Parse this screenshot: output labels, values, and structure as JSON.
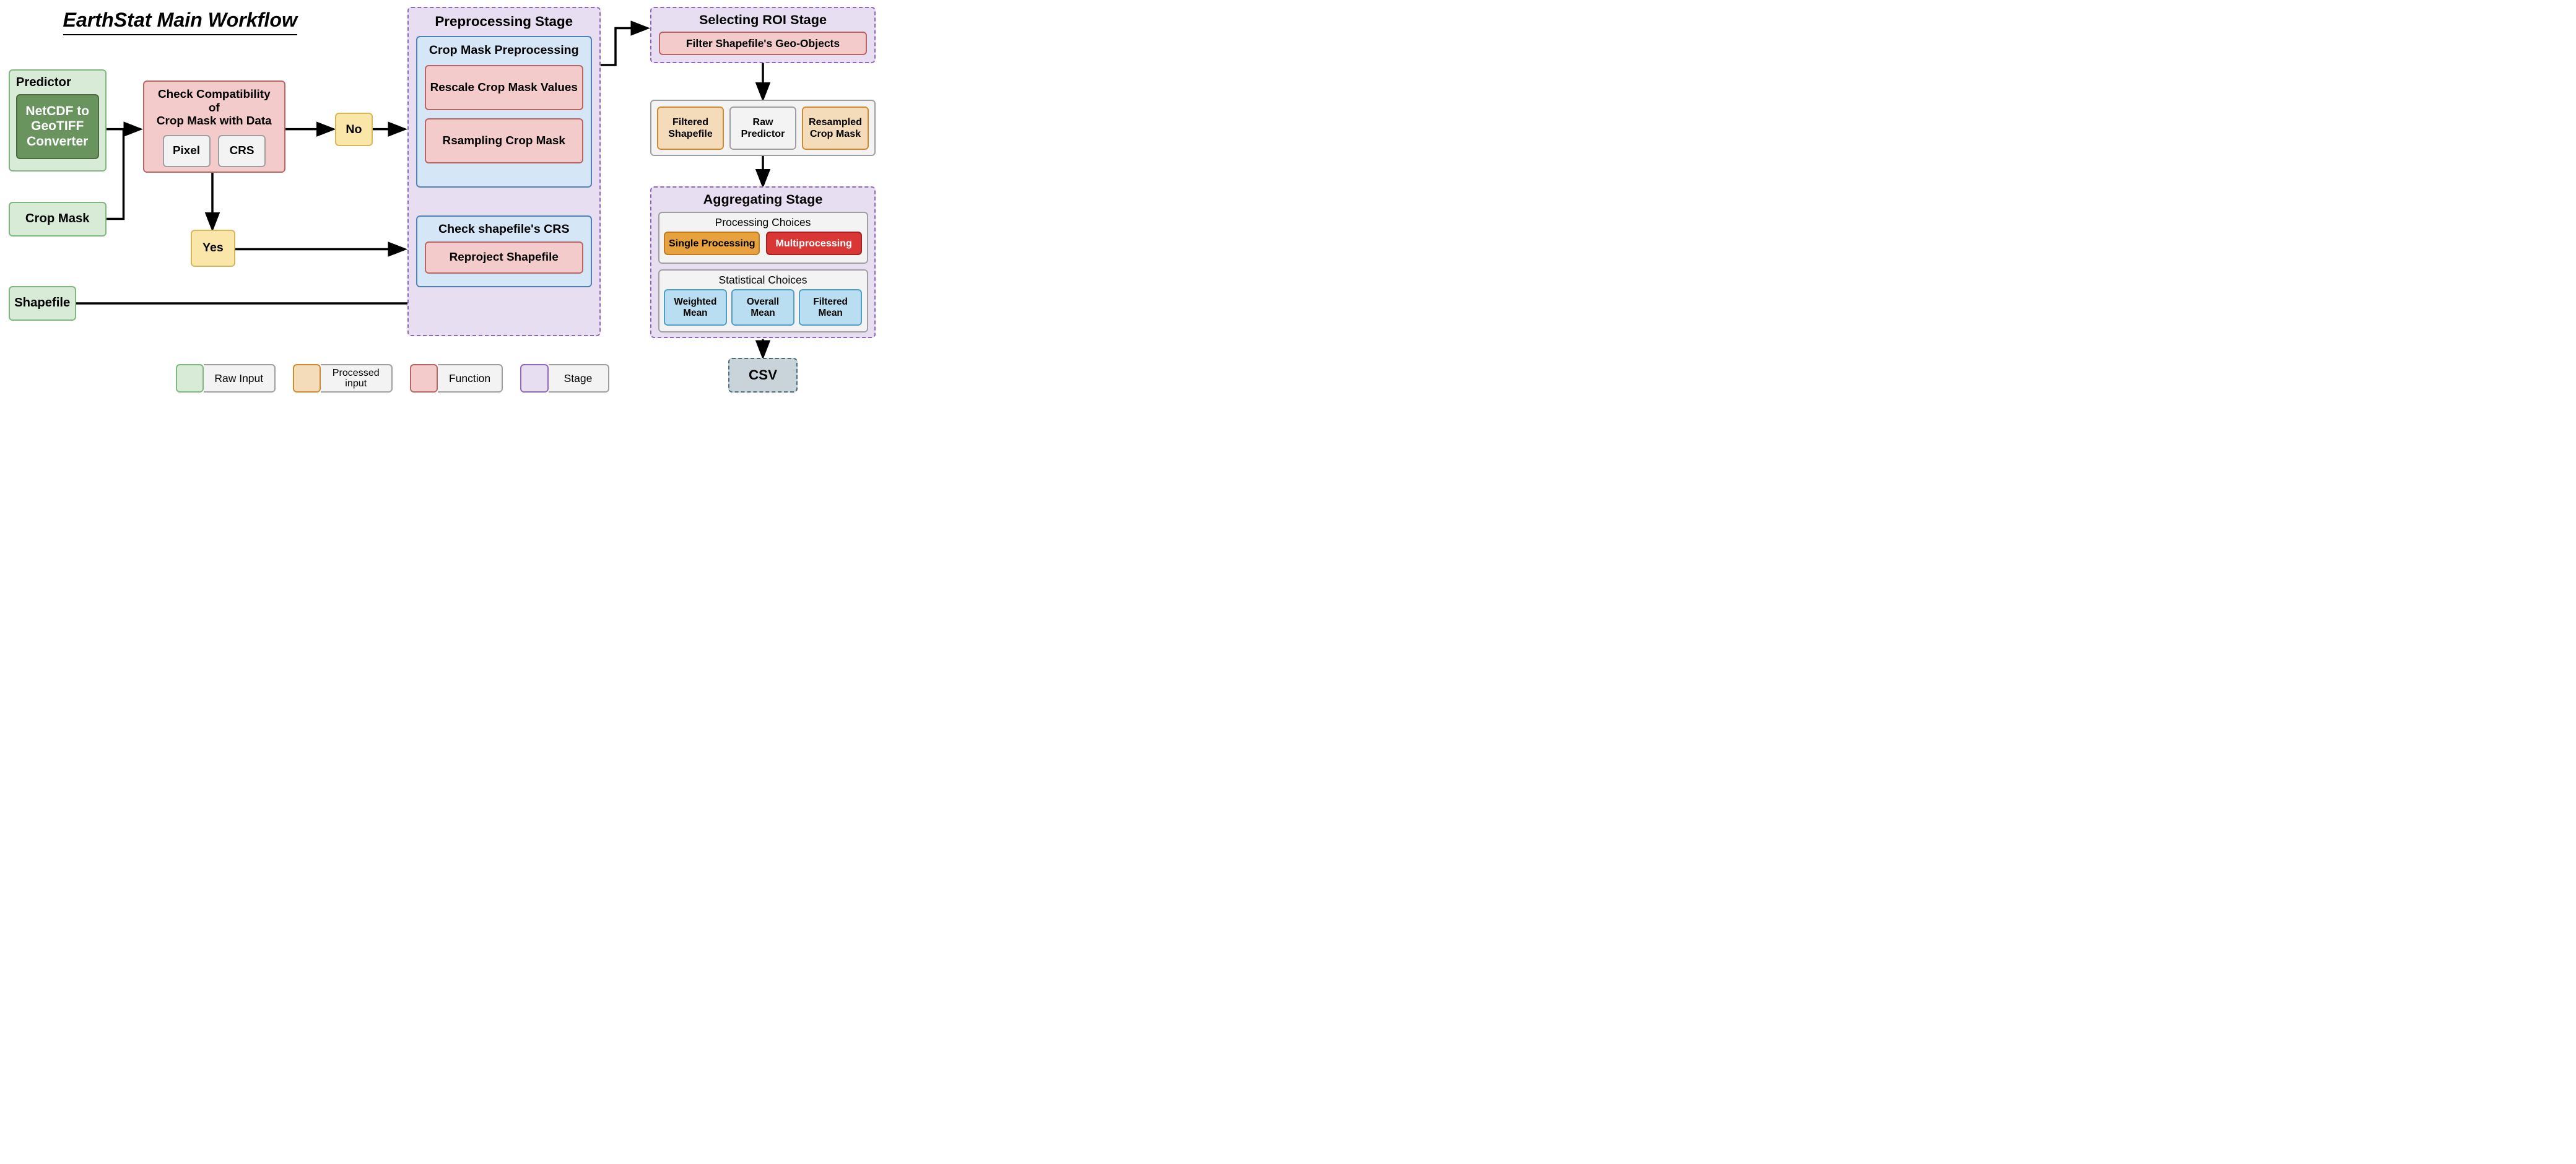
{
  "title": "EarthStat Main Workflow",
  "inputs": {
    "predictor_label": "Predictor",
    "converter": "NetCDF to GeoTIFF Converter",
    "crop_mask": "Crop Mask",
    "shapefile": "Shapefile"
  },
  "check": {
    "title1": "Check Compatibility of",
    "title2": "Crop Mask with Data",
    "pixel": "Pixel",
    "crs": "CRS"
  },
  "decision": {
    "no": "No",
    "yes": "Yes"
  },
  "preprocessing": {
    "stage_title": "Preprocessing Stage",
    "cm_prep_title": "Crop Mask Preprocessing",
    "rescale": "Rescale Crop Mask Values",
    "resample": "Rsampling Crop Mask",
    "shp_crs_title": "Check shapefile's CRS",
    "reproject": "Reproject Shapefile"
  },
  "roi": {
    "stage_title": "Selecting ROI Stage",
    "filter": "Filter Shapefile's Geo-Objects"
  },
  "processed_inputs": {
    "filtered_shp": "Filtered Shapefile",
    "raw_predictor": "Raw Predictor",
    "resampled_cm": "Resampled Crop Mask"
  },
  "aggregating": {
    "stage_title": "Aggregating Stage",
    "processing_title": "Processing Choices",
    "single": "Single Processing",
    "multi": "Multiprocessing",
    "stat_title": "Statistical Choices",
    "weighted": "Weighted Mean",
    "overall": "Overall Mean",
    "filtered": "Filtered Mean"
  },
  "output": "CSV",
  "legend": {
    "raw_input": "Raw Input",
    "processed_input": "Processed input",
    "function": "Function",
    "stage": "Stage"
  },
  "colors": {
    "green_fill": "#d8ebd7",
    "green_border": "#7fb77e",
    "dkgreen_fill": "#6a945e",
    "dkgreen_border": "#4a6b40",
    "red_fill": "#f4cbcb",
    "red_border": "#b96565",
    "yellow_fill": "#fae6a8",
    "yellow_border": "#d8b75a",
    "purple_fill": "#e7dff1",
    "purple_border": "#8c68b5",
    "blue_fill": "#d5e7f6",
    "blue_border": "#4f82b2",
    "grey_fill": "#f3f3f3",
    "grey_border": "#9f9f9f",
    "orange_fill": "#f4dbb9",
    "orange_border": "#d08a2e",
    "orange_strong": "#e7a23f",
    "red_strong": "#d93636",
    "lblue_fill": "#b9def1",
    "lblue_border": "#4f9ec6",
    "slate_fill": "#c9d4da",
    "slate_border": "#4b6a7e"
  }
}
